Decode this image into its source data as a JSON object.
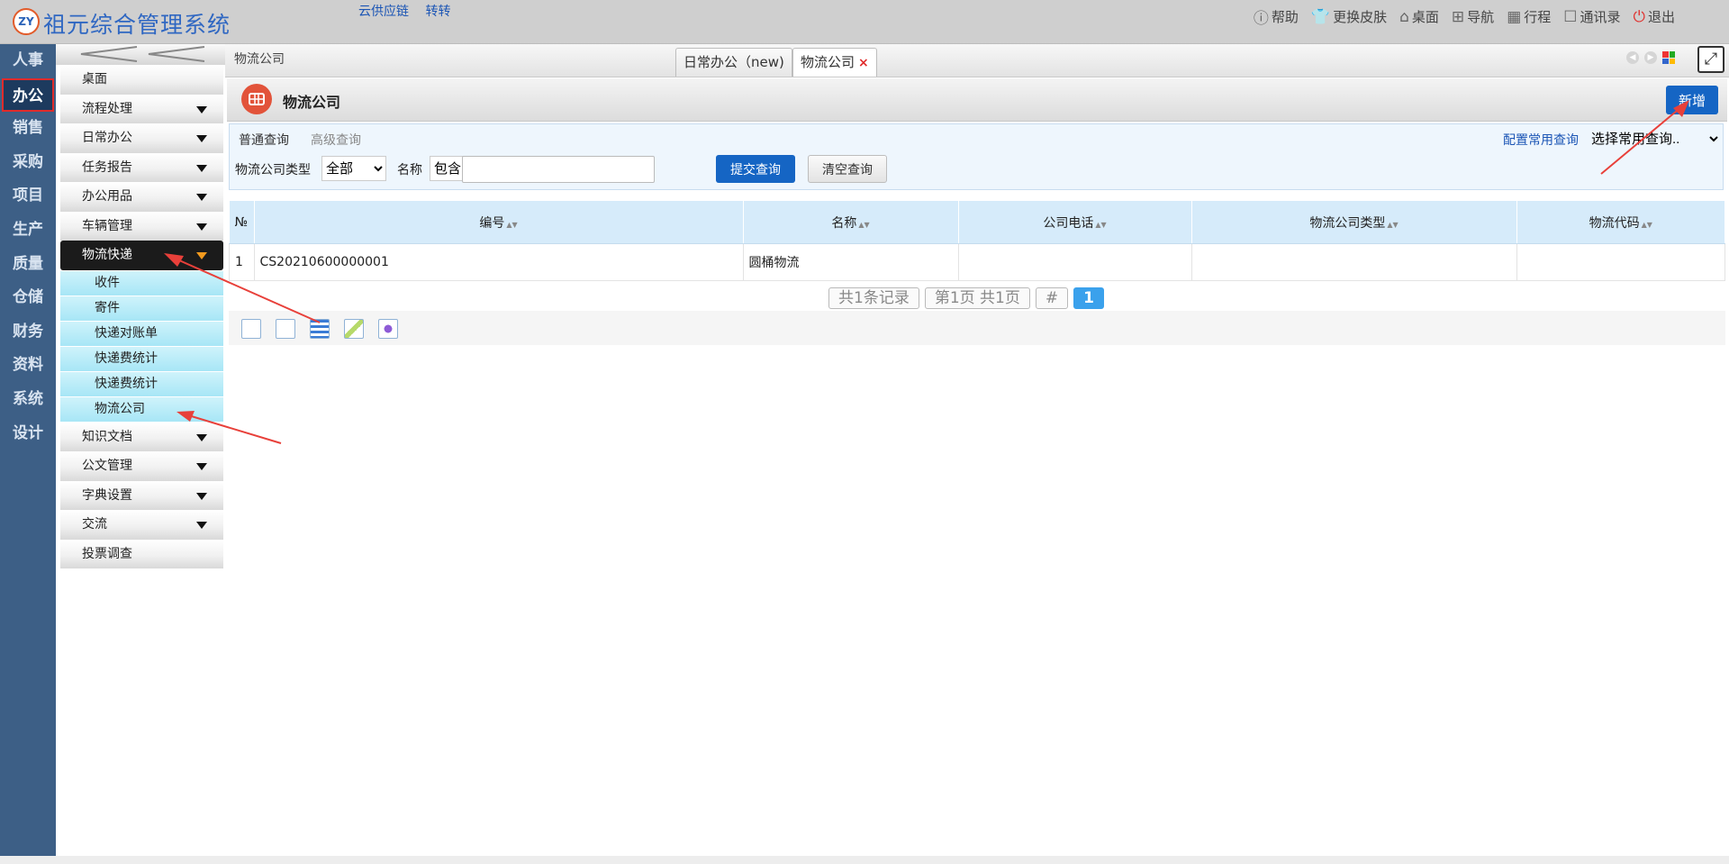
{
  "header": {
    "logo_text": "ZY",
    "app_title": "祖元综合管理系统",
    "links": [
      "云供应链",
      "转转"
    ],
    "actions": [
      {
        "label": "帮助",
        "icon": "help-icon"
      },
      {
        "label": "更换皮肤",
        "icon": "shirt-icon"
      },
      {
        "label": "桌面",
        "icon": "home-icon"
      },
      {
        "label": "导航",
        "icon": "grid-icon"
      },
      {
        "label": "行程",
        "icon": "calendar-icon"
      },
      {
        "label": "通讯录",
        "icon": "contacts-icon"
      },
      {
        "label": "退出",
        "icon": "power-icon"
      }
    ]
  },
  "rail": {
    "items": [
      "人事",
      "办公",
      "销售",
      "采购",
      "项目",
      "生产",
      "质量",
      "仓储",
      "财务",
      "资料",
      "系统",
      "设计"
    ],
    "active": "办公"
  },
  "sidebar": {
    "items_before": [
      "桌面",
      "流程处理",
      "日常办公",
      "任务报告",
      "办公用品",
      "车辆管理"
    ],
    "open_item": "物流快递",
    "sub_items": [
      "收件",
      "寄件",
      "快递对账单",
      "快递费统计",
      "快递费统计",
      "物流公司"
    ],
    "items_after": [
      "知识文档",
      "公文管理",
      "字典设置",
      "交流",
      "投票调查"
    ]
  },
  "tabs": {
    "breadcrumb": "物流公司",
    "items": [
      {
        "label": "日常办公（new)"
      },
      {
        "label": "物流公司",
        "close": "×"
      }
    ]
  },
  "page": {
    "title": "物流公司",
    "add_button": "新增"
  },
  "query": {
    "tab_normal": "普通查询",
    "tab_advanced": "高级查询",
    "config_link": "配置常用查询",
    "common_select": "选择常用查询..",
    "type_label": "物流公司类型",
    "type_value": "全部",
    "name_label": "名称",
    "name_op": "包含",
    "name_value": "",
    "submit": "提交查询",
    "clear": "清空查询"
  },
  "table": {
    "columns": [
      "№",
      "编号",
      "名称",
      "公司电话",
      "物流公司类型",
      "物流代码"
    ],
    "rows": [
      [
        "1",
        "CS20210600000001",
        "圆桶物流",
        "",
        "",
        ""
      ]
    ]
  },
  "pager": {
    "total": "共1条记录",
    "page_info": "第1页 共1页",
    "hash": "#",
    "current": "1"
  },
  "colors": {
    "rail_bg": "#3d5f86",
    "primary": "#1565c4",
    "header_row": "#d6ebfa",
    "sub_menu": "#a7e6f6",
    "annotation": "#e8403a"
  }
}
